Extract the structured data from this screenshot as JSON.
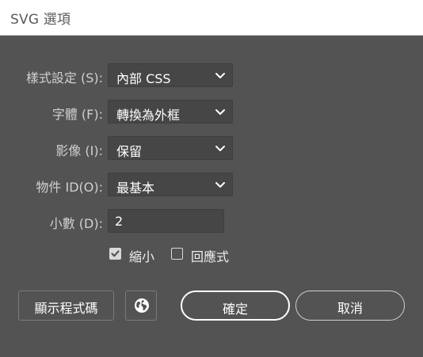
{
  "window": {
    "title": "SVG 選項"
  },
  "form": {
    "style": {
      "label": "樣式設定 (S):",
      "value": "內部 CSS"
    },
    "font": {
      "label": "字體 (F):",
      "value": "轉換為外框"
    },
    "image": {
      "label": "影像 (I):",
      "value": "保留"
    },
    "object_id": {
      "label": "物件 ID(O):",
      "value": "最基本"
    },
    "decimal": {
      "label": "小數 (D):",
      "value": "2"
    }
  },
  "options": {
    "minify": {
      "label": "縮小",
      "checked": true
    },
    "responsive": {
      "label": "回應式",
      "checked": false
    }
  },
  "buttons": {
    "show_code": "顯示程式碼",
    "ok": "確定",
    "cancel": "取消"
  },
  "icons": {
    "select_arrow": "chevron-down-icon",
    "checkmark": "checkmark-icon",
    "web_preview": "globe-icon"
  },
  "colors": {
    "background": "#535353",
    "titlebar": "#ffffff",
    "field": "#464646",
    "text": "#ffffff",
    "label_text": "#d0d0d0"
  }
}
